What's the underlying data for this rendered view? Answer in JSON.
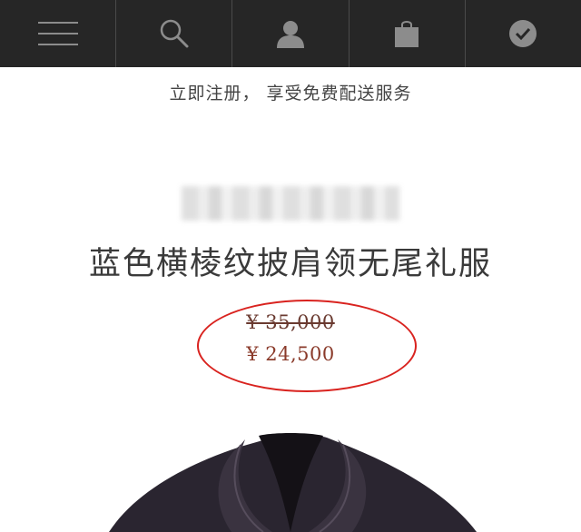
{
  "nav": {
    "items": [
      {
        "icon": "menu-icon"
      },
      {
        "icon": "search-icon"
      },
      {
        "icon": "user-icon"
      },
      {
        "icon": "shopping-bag-icon"
      },
      {
        "icon": "check-icon"
      }
    ],
    "colors": {
      "background": "#262626",
      "icon": "#8c8c8c"
    }
  },
  "promo": {
    "text": "立即注册， 享受免费配送服务"
  },
  "product": {
    "title": "蓝色横棱纹披肩领无尾礼服",
    "original_price": "¥ 35,000",
    "sale_price": "¥ 24,500"
  },
  "annotation": {
    "circle_color": "#d9231f"
  }
}
